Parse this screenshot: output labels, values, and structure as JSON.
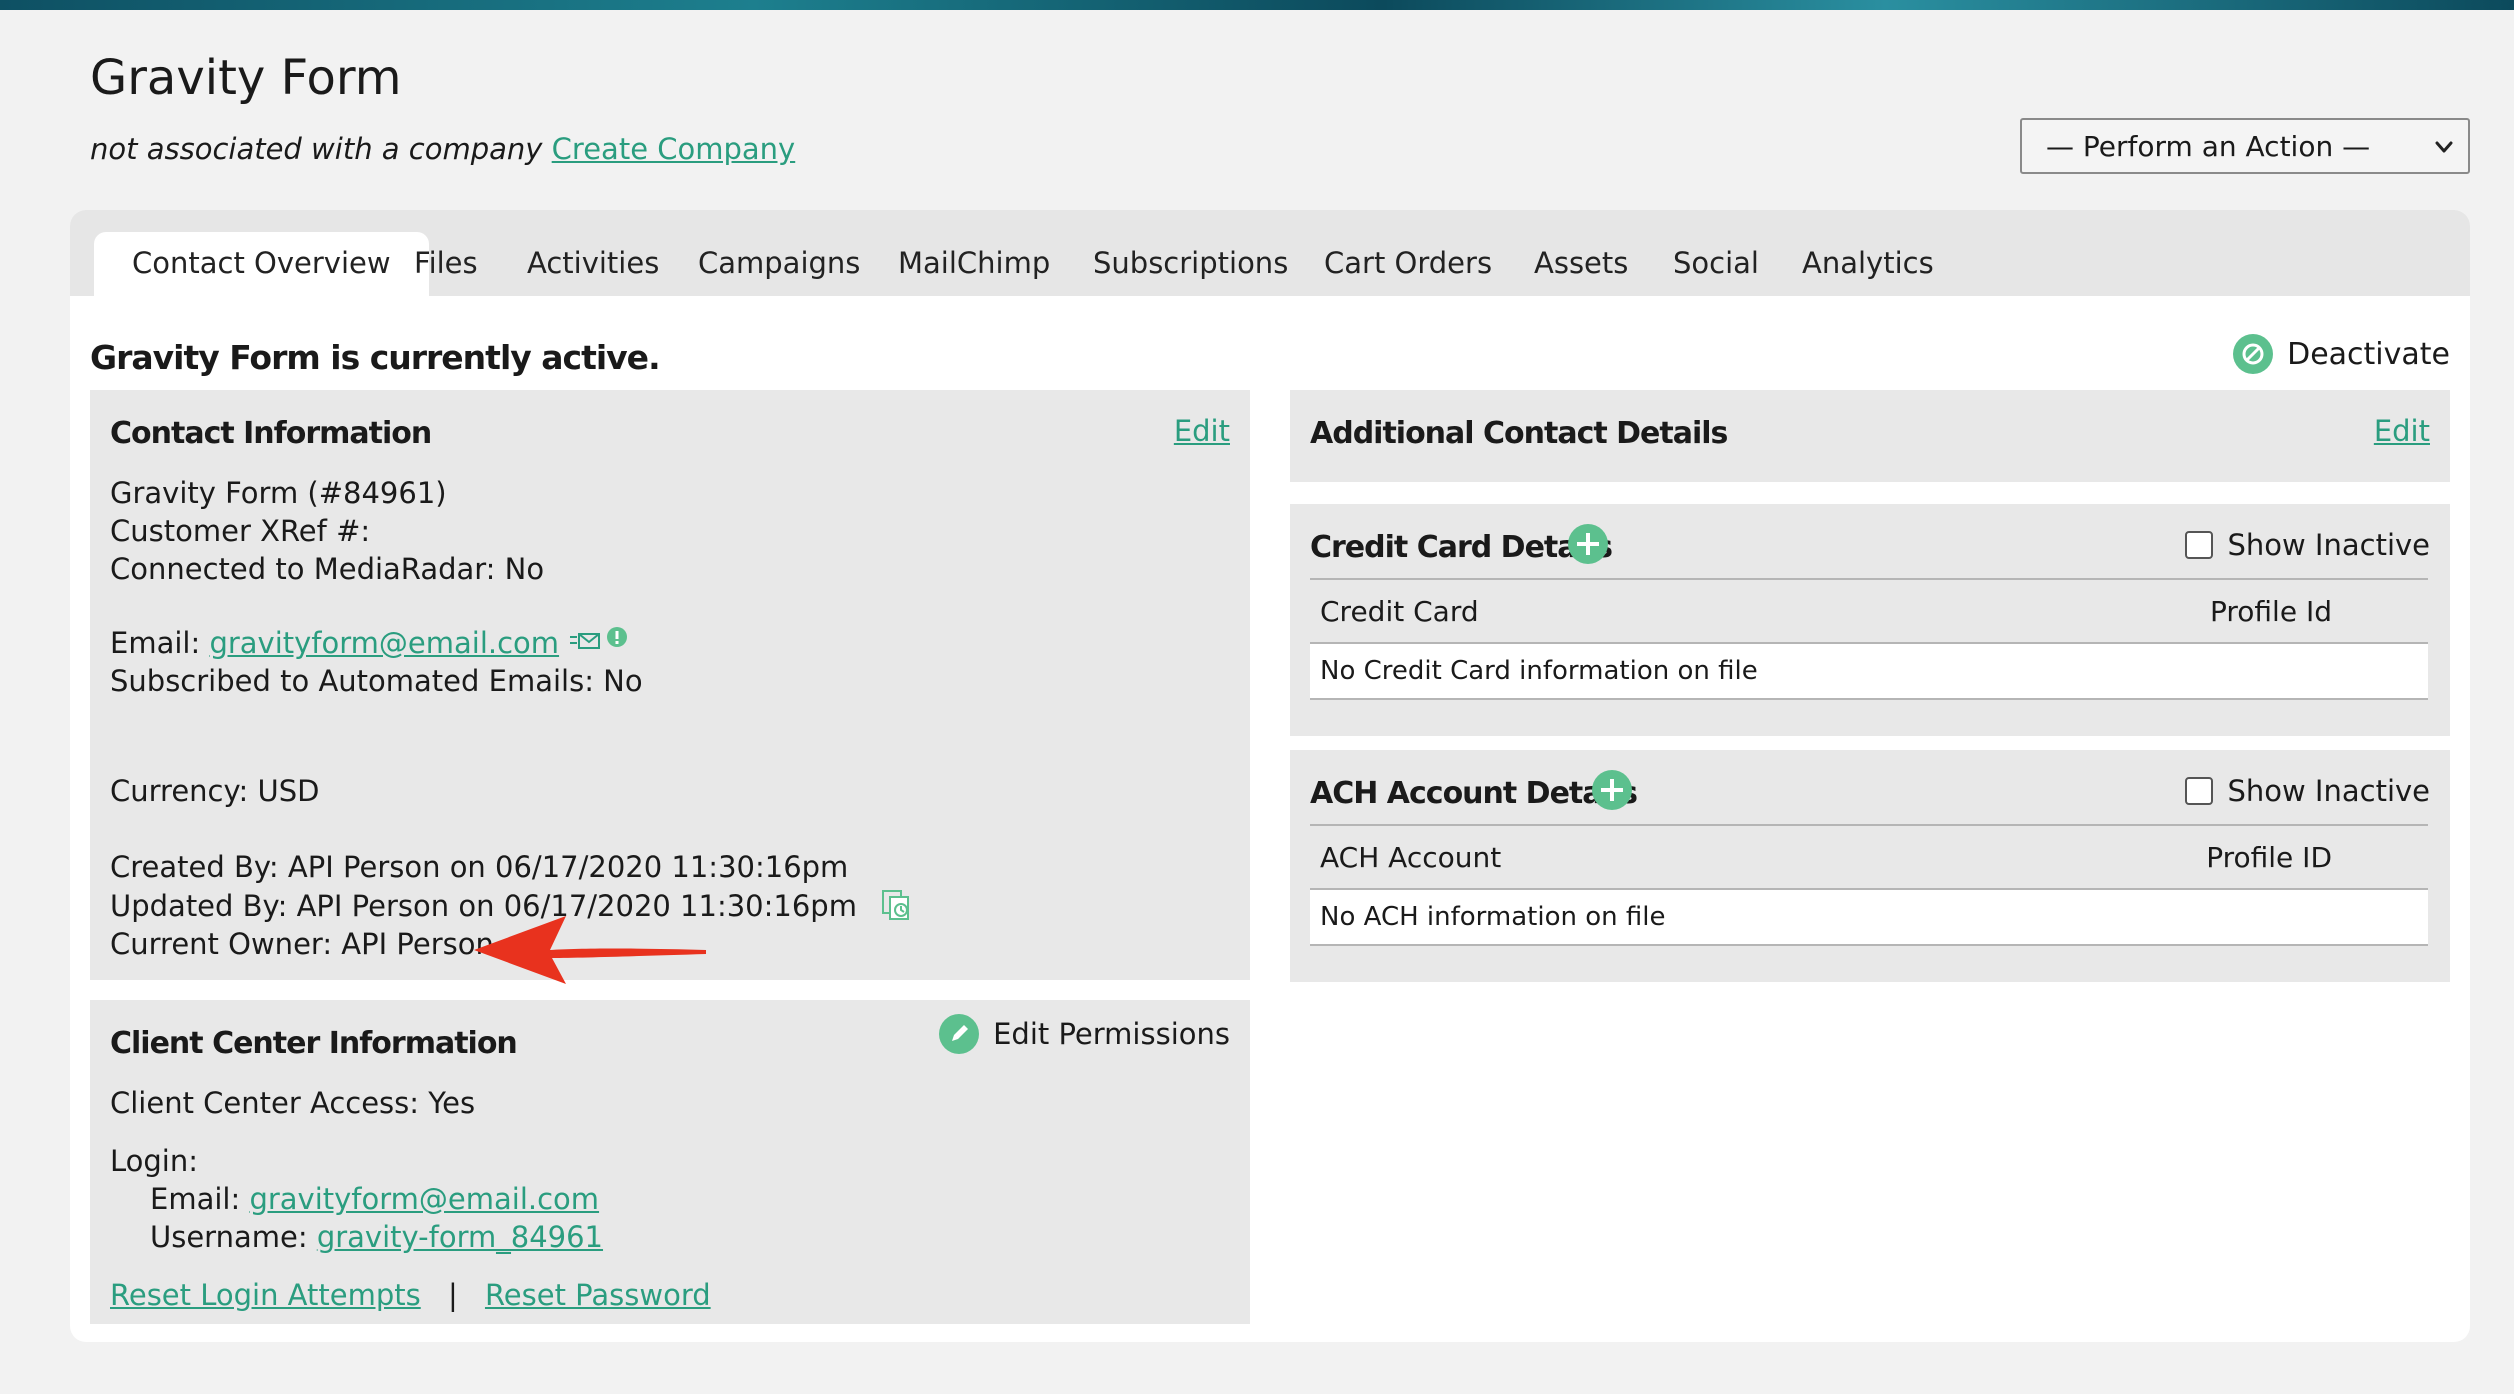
{
  "header": {
    "title": "Gravity Form",
    "association_text": "not associated with a company",
    "create_company_link": "Create Company",
    "action_select": "— Perform an Action —"
  },
  "tabs": [
    {
      "label": "Contact Overview",
      "active": true
    },
    {
      "label": "Files"
    },
    {
      "label": "Activities"
    },
    {
      "label": "Campaigns"
    },
    {
      "label": "MailChimp"
    },
    {
      "label": "Subscriptions"
    },
    {
      "label": "Cart Orders"
    },
    {
      "label": "Assets"
    },
    {
      "label": "Social"
    },
    {
      "label": "Analytics"
    }
  ],
  "status": {
    "text": "Gravity Form is currently active.",
    "deactivate_label": "Deactivate"
  },
  "contact_info": {
    "title": "Contact Information",
    "edit": "Edit",
    "name_line": "Gravity Form (#84961)",
    "xref_line": "Customer XRef #:",
    "mediaradar_line": "Connected to MediaRadar: No",
    "email_label": "Email:",
    "email_value": "gravityform@email.com",
    "subscribed_line": "Subscribed to Automated Emails: No",
    "currency_line": "Currency: USD",
    "created_line": "Created By: API Person on 06/17/2020 11:30:16pm",
    "updated_line": "Updated By: API Person on 06/17/2020 11:30:16pm",
    "owner_line": "Current Owner: API Person"
  },
  "client_center": {
    "title": "Client Center Information",
    "edit_permissions": "Edit Permissions",
    "access_line": "Client Center Access: Yes",
    "login_label": "Login:",
    "email_label": "Email:",
    "email_value": "gravityform@email.com",
    "username_label": "Username:",
    "username_value": "gravity-form_84961",
    "reset_attempts": "Reset Login Attempts",
    "separator": "|",
    "reset_password": "Reset Password"
  },
  "additional_details": {
    "title": "Additional Contact Details",
    "edit": "Edit"
  },
  "credit_card": {
    "title": "Credit Card Details",
    "show_inactive": "Show Inactive",
    "col1": "Credit Card",
    "col2": "Profile Id",
    "empty": "No Credit Card information on file"
  },
  "ach": {
    "title": "ACH Account Details",
    "show_inactive": "Show Inactive",
    "col1": "ACH Account",
    "col2": "Profile ID",
    "empty": "No ACH information on file"
  },
  "colors": {
    "accent_green": "#2a9d7f",
    "icon_green": "#5cc08e",
    "arrow_red": "#e8321e"
  }
}
